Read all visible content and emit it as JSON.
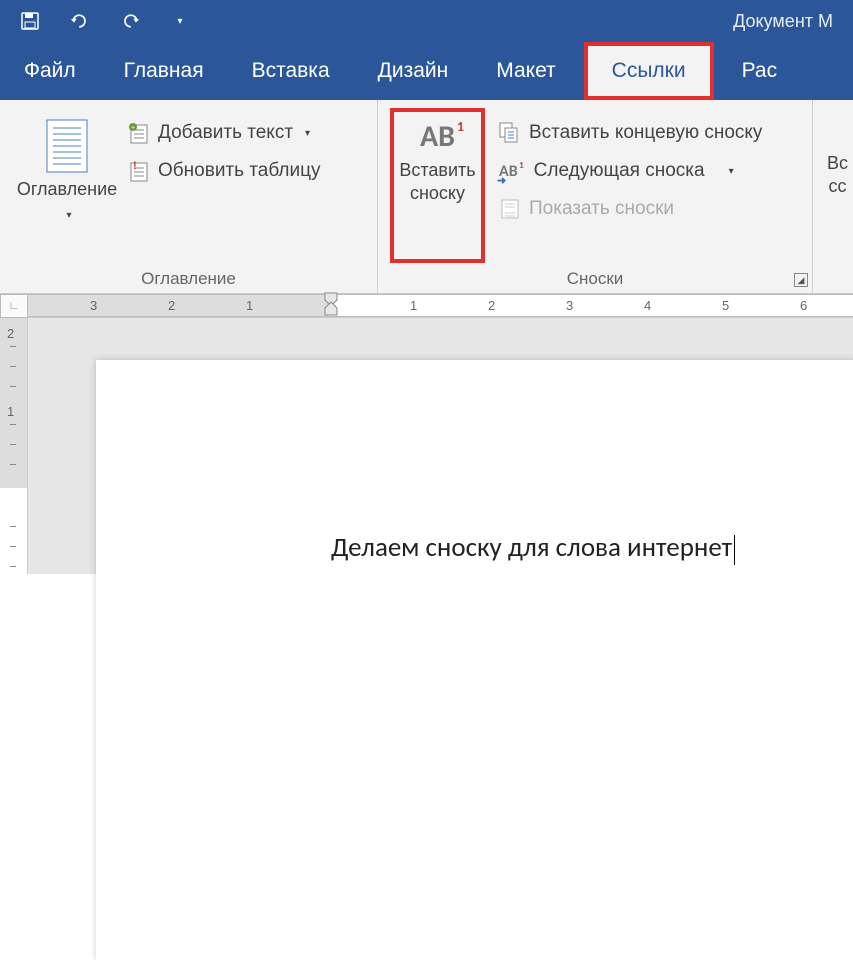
{
  "title": "Документ M",
  "tabs": {
    "file": "Файл",
    "home": "Главная",
    "insert": "Вставка",
    "design": "Дизайн",
    "layout": "Макет",
    "references": "Ссылки",
    "mailings": "Рас"
  },
  "ribbon": {
    "toc": {
      "group_label": "Оглавление",
      "toc_btn": "Оглавление",
      "add_text": "Добавить текст",
      "update_table": "Обновить таблицу"
    },
    "footnotes": {
      "group_label": "Сноски",
      "insert_footnote_line1": "Вставить",
      "insert_footnote_line2": "сноску",
      "insert_endnote": "Вставить концевую сноску",
      "next_footnote": "Следующая сноска",
      "show_notes": "Показать сноски"
    },
    "citations": {
      "line1": "Вс",
      "line2": "сс"
    }
  },
  "document": {
    "text": "Делаем сноску для слова интернет"
  },
  "ruler": {
    "h_numbers": [
      "3",
      "2",
      "1",
      "1",
      "2",
      "3",
      "4",
      "5",
      "6"
    ],
    "v_numbers": [
      "2",
      "1"
    ]
  }
}
